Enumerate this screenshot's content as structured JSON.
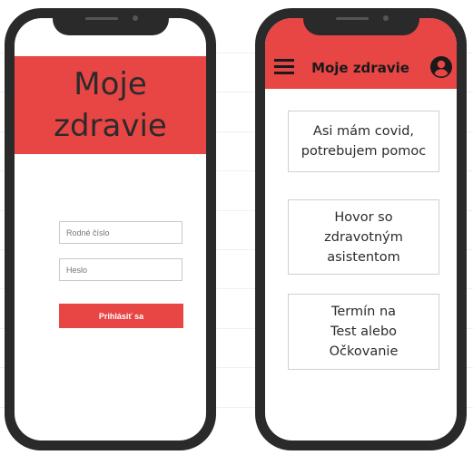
{
  "login_screen": {
    "hero_title_line1": "Moje",
    "hero_title_line2": "zdravie",
    "birth_number_placeholder": "Rodné číslo",
    "password_placeholder": "Heslo",
    "login_button_label": "Prihlásiť sa"
  },
  "home_screen": {
    "title": "Moje zdravie",
    "menu_icon": "hamburger-menu-icon",
    "user_icon": "user-account-icon",
    "cards": [
      {
        "line1": "Asi mám covid,",
        "line2": "potrebujem pomoc",
        "line3": ""
      },
      {
        "line1": "Hovor so",
        "line2": "zdravotným",
        "line3": "asistentom"
      },
      {
        "line1": "Termín na",
        "line2": "Test alebo",
        "line3": "Očkovanie"
      }
    ]
  },
  "colors": {
    "accent": "#e84545",
    "phone_frame": "#2a2a2a",
    "text": "#2b2b2b"
  }
}
